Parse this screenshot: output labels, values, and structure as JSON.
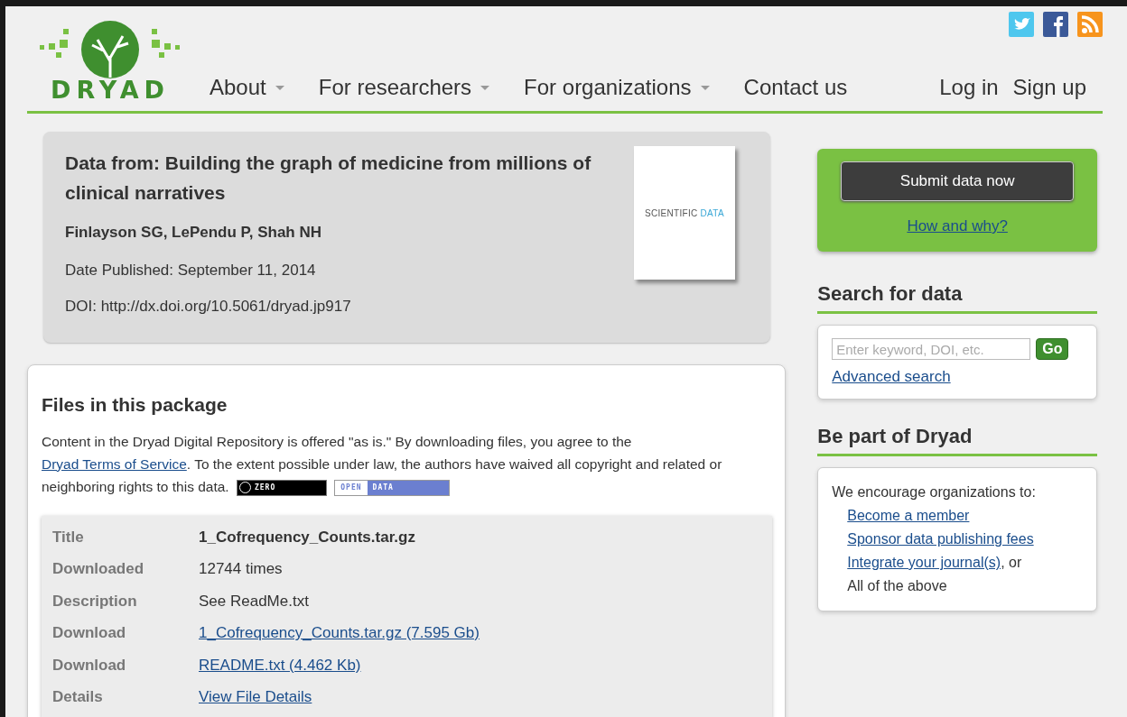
{
  "header": {
    "logo_text": "DRYAD",
    "nav": [
      {
        "label": "About",
        "has_menu": true
      },
      {
        "label": "For researchers",
        "has_menu": true
      },
      {
        "label": "For organizations",
        "has_menu": true
      },
      {
        "label": "Contact us",
        "has_menu": false
      }
    ],
    "account": [
      "Log in",
      "Sign up"
    ]
  },
  "record": {
    "title": "Data from: Building the graph of medicine from millions of clinical narratives",
    "authors": "Finlayson SG, LePendu P, Shah NH",
    "date": "Date Published: September 11, 2014",
    "doi": "DOI: http://dx.doi.org/10.5061/dryad.jp917",
    "cover": {
      "brand": "SCIENTIFIC",
      "accent": "DATA"
    }
  },
  "files": {
    "heading": "Files in this package",
    "notice_before": "Content in the Dryad Digital Repository is offered \"as is.\" By downloading files, you agree to the ",
    "notice_link": "Dryad Terms of Service",
    "notice_after": ". To the extent possible under law, the authors have waived all copyright and related or neighboring rights to this data.",
    "badges": [
      {
        "kind": "cc0",
        "text": "ZERO"
      },
      {
        "kind": "open",
        "text": "OPEN",
        "accent": "DATA"
      }
    ],
    "rows": [
      {
        "label": "Title",
        "value": "1_Cofrequency_Counts.tar.gz",
        "kind": "title"
      },
      {
        "label": "Downloaded",
        "value": "12744 times",
        "kind": "text"
      },
      {
        "label": "Description",
        "value": "See ReadMe.txt",
        "kind": "text"
      },
      {
        "label": "Download",
        "value": "1_Cofrequency_Counts.tar.gz (7.595 Gb)",
        "kind": "link"
      },
      {
        "label": "Download",
        "value": "README.txt (4.462 Kb)",
        "kind": "link"
      },
      {
        "label": "Details",
        "value": "View File Details",
        "kind": "link"
      }
    ]
  },
  "sidebar": {
    "submit_button": "Submit data now",
    "how_link": "How and why?",
    "search_heading": "Search for data",
    "search_placeholder": "Enter keyword, DOI, etc.",
    "go_button": "Go",
    "advanced_link": "Advanced search",
    "part_heading": "Be part of Dryad",
    "part_intro": "We encourage organizations to:",
    "part_items": [
      {
        "text": "Become a member",
        "kind": "link"
      },
      {
        "text": "Sponsor data publishing fees",
        "kind": "link"
      },
      {
        "text": "Integrate your journal(s)",
        "kind": "link",
        "suffix": ", or"
      },
      {
        "text": "All of the above",
        "kind": "text"
      }
    ]
  }
}
